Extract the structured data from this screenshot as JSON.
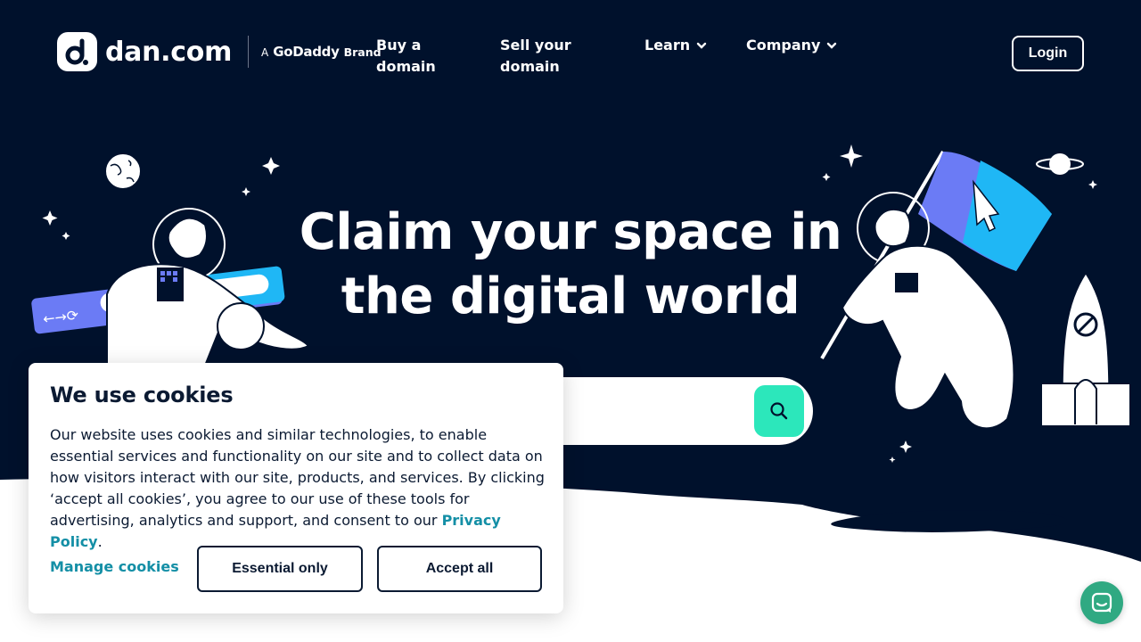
{
  "colors": {
    "navy": "#00112c",
    "accent_teal": "#2ce7bb",
    "link_teal": "#148fa6",
    "chat_green": "#30a982"
  },
  "nav": {
    "logo_text": "dan.com",
    "brand_prefix": "A",
    "brand_name": "GoDaddy",
    "brand_suffix": "Brand",
    "buy_label": "Buy a domain",
    "sell_label": "Sell your domain",
    "learn_label": "Learn",
    "company_label": "Company",
    "login_label": "Login"
  },
  "hero": {
    "headline": "Claim your space in the digital world",
    "search_placeholder": "",
    "search_icon": "search-icon"
  },
  "cookie": {
    "title": "We use cookies",
    "body": "Our website uses cookies and similar technologies, to enable essential services and functionality on our site and to collect data on how visitors interact with our site, products, and services. By clicking ‘accept all cookies’, you agree to our use of these tools for advertising, analytics and support, and consent to our",
    "privacy_link": "Privacy Policy",
    "body_end": ".",
    "manage_label": "Manage cookies",
    "essential_label": "Essential only",
    "accept_label": "Accept all"
  },
  "chat": {
    "icon": "chat-icon"
  }
}
